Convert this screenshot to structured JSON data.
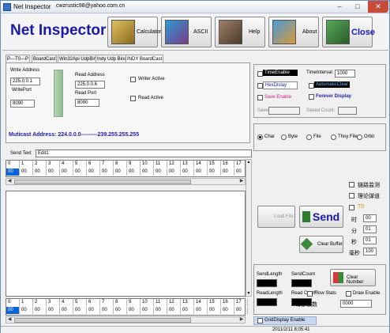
{
  "window": {
    "title": "Net Inspector",
    "subtitle": "cwzrustic98@yahoo.com.cn"
  },
  "header": {
    "brand": "Net Inspector",
    "buttons": {
      "calculator": "Calculator",
      "ascii": "ASCII",
      "help": "Help",
      "about": "About",
      "close": "Close"
    }
  },
  "tabs": [
    "P---T0---P",
    "BoardCast",
    "Win32Api UdpBind",
    "Indy Udp Bind",
    "INDY BoardCast"
  ],
  "left": {
    "write_address_label": "Write Address",
    "write_address": "225.0.0.1",
    "write_port_label": "WritePort",
    "write_port": "8090",
    "read_address_label": "Read Address",
    "read_address": "225.0.0.6",
    "read_port_label": "Read Port",
    "read_port": "8090",
    "writer_active": "Writer Active",
    "read_active": "Read Active",
    "multicast": "Muticast Address:  224.0.0.0---------239.255.255.255"
  },
  "right": {
    "time_enable": "TimeEnable",
    "time_interval_label": "TimeInterval",
    "time_interval": "1000",
    "hex_display": "HexDislay",
    "automatic_clear": "AutomaticClear",
    "save_enable": "Save Enable",
    "forever_display": "Forever Display",
    "save_label": "Save",
    "saved_count_label": "Saved Count:",
    "radios": [
      "Char",
      "Byte",
      "File",
      "Thoy File",
      "Orbit"
    ]
  },
  "send": {
    "label": "Send Text",
    "edit": "Edit1"
  },
  "grid": {
    "headers": [
      "0",
      "1",
      "2",
      "3",
      "4",
      "5",
      "6",
      "7",
      "8",
      "9",
      "10",
      "11",
      "12",
      "13",
      "14",
      "15",
      "16",
      "17"
    ],
    "values": [
      "00",
      "00",
      "00",
      "00",
      "00",
      "00",
      "00",
      "00",
      "00",
      "00",
      "00",
      "00",
      "00",
      "00",
      "00",
      "00",
      "00",
      "00"
    ]
  },
  "controls": {
    "load_file": "Load File",
    "send": "Send",
    "clear_buffer": "Clear Buffer",
    "clear_number": "Clear Number",
    "cn1": "链路监测",
    "cn2": "理论弹道",
    "t0": "T0",
    "hour": "时",
    "minute": "分",
    "second": "秒",
    "ms": "毫秒",
    "hour_v": "00",
    "minute_v": "01",
    "second_v": "01",
    "ms_v": "100",
    "send_length": "SendLength",
    "send_count": "SendCount",
    "read_length": "ReadLength",
    "read_count": "Read Count",
    "flow_stats": "Flow Stats",
    "draw_enable": "Draw Enable",
    "frames_label": "每秒帧数",
    "frames_value": "0000",
    "grid_display": "GridDisplay Enable"
  },
  "status": {
    "datetime": "2011/2/11  8:05:41"
  },
  "colors": {
    "brand": "#1a1aa6",
    "selection": "#0a64d8",
    "red_text": "#d41a8a"
  }
}
